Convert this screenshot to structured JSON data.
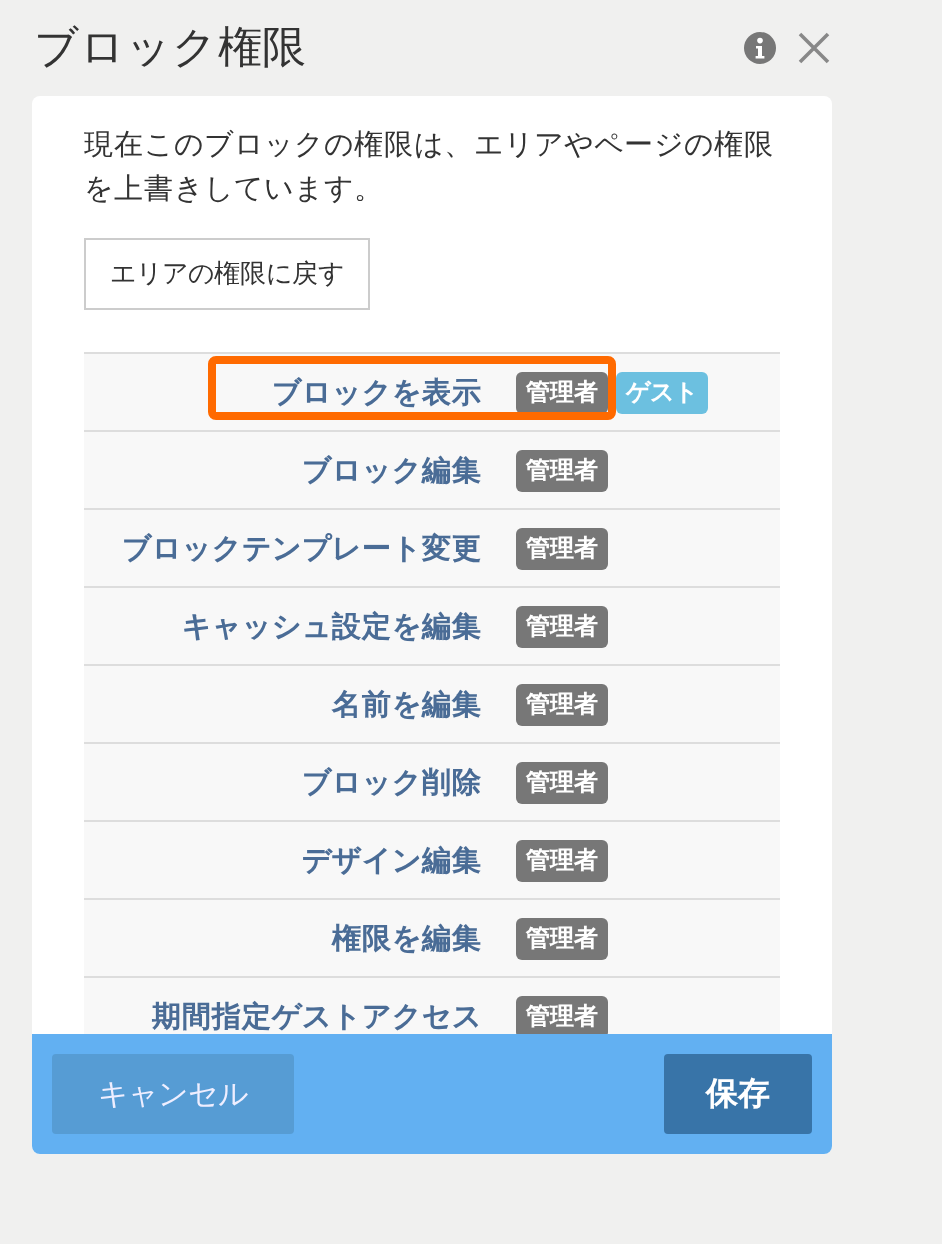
{
  "dialog": {
    "title": "ブロック権限"
  },
  "notice": "現在このブロックの権限は、エリアやページの権限を上書きしています。",
  "revert_button": "エリアの権限に戻す",
  "permissions": [
    {
      "label": "ブロックを表示",
      "highlighted": true,
      "badges": [
        {
          "label": "管理者",
          "color": "#777777"
        },
        {
          "label": "ゲスト",
          "color": "#6cc0e0"
        }
      ]
    },
    {
      "label": "ブロック編集",
      "highlighted": false,
      "badges": [
        {
          "label": "管理者",
          "color": "#777777"
        }
      ]
    },
    {
      "label": "ブロックテンプレート変更",
      "highlighted": false,
      "badges": [
        {
          "label": "管理者",
          "color": "#777777"
        }
      ]
    },
    {
      "label": "キャッシュ設定を編集",
      "highlighted": false,
      "badges": [
        {
          "label": "管理者",
          "color": "#777777"
        }
      ]
    },
    {
      "label": "名前を編集",
      "highlighted": false,
      "badges": [
        {
          "label": "管理者",
          "color": "#777777"
        }
      ]
    },
    {
      "label": "ブロック削除",
      "highlighted": false,
      "badges": [
        {
          "label": "管理者",
          "color": "#777777"
        }
      ]
    },
    {
      "label": "デザイン編集",
      "highlighted": false,
      "badges": [
        {
          "label": "管理者",
          "color": "#777777"
        }
      ]
    },
    {
      "label": "権限を編集",
      "highlighted": false,
      "badges": [
        {
          "label": "管理者",
          "color": "#777777"
        }
      ]
    },
    {
      "label": "期間指定ゲストアクセス",
      "highlighted": false,
      "badges": [
        {
          "label": "管理者",
          "color": "#777777"
        }
      ]
    }
  ],
  "footer": {
    "cancel": "キャンセル",
    "save": "保存"
  }
}
